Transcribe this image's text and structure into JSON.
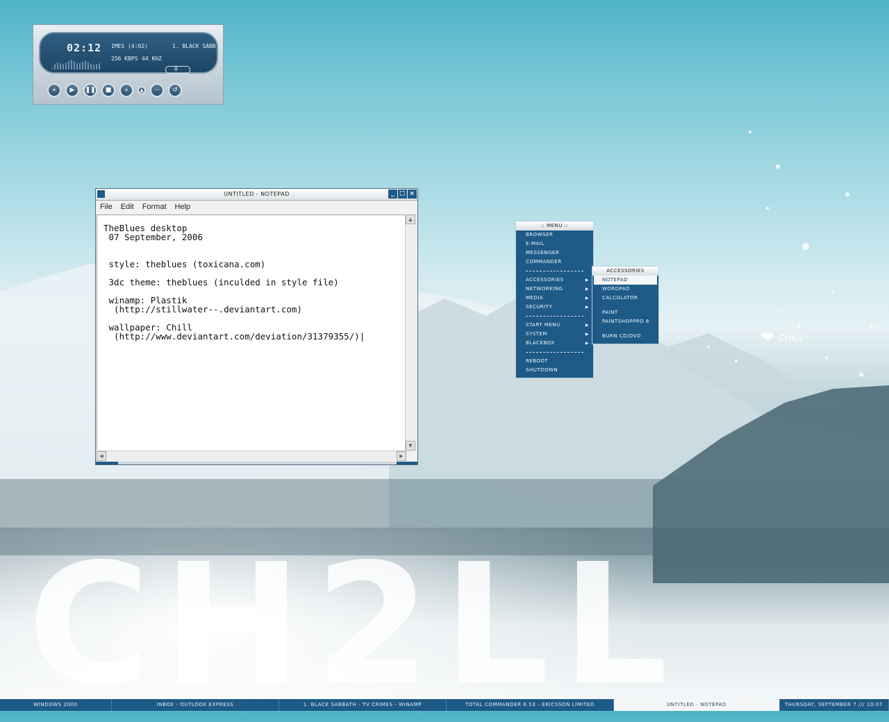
{
  "winamp": {
    "time": "02:12",
    "title_scroll": "IMES (4:02)",
    "track": "1. BLACK SABB",
    "kbps_label": "256 KBPS",
    "khz_label": "44 KHZ",
    "seek_label": "0"
  },
  "notepad": {
    "title": "UNTITLED - NOTEPAD",
    "menu": [
      "File",
      "Edit",
      "Format",
      "Help"
    ],
    "content": "TheBlues desktop\n 07 September, 2006\n\n\n style: theblues (toxicana.com)\n\n 3dc theme: theblues (inculded in style file)\n\n winamp: Plastik\n  (http://stillwater--.deviantart.com)\n\n wallpaper: Chill\n  (http://www.deviantart.com/deviation/31379355/)|"
  },
  "start_menu": {
    "title": ":: MENU ::",
    "items": [
      "BROWSER",
      "E-MAIL",
      "MESSENGER",
      "COMMANDER",
      "ACCESSORIES",
      "NETWORKING",
      "MEDIA",
      "SECURITY",
      "START MENU",
      "SYSTEM",
      "BLACKBOX",
      "REBOOT",
      "SHUTDOWN"
    ]
  },
  "submenu": {
    "title": "ACCESSORIES",
    "items": [
      "NOTEPAD",
      "WORDPAD",
      "CALCULATOR",
      "PAINT",
      "PAINTSHOPPRO 8",
      "BURN CD/DVD"
    ]
  },
  "wallpaper": {
    "logo_text": "CHILL",
    "big_text": "CH2LL"
  },
  "taskbar": {
    "items": [
      "WINDOWS 2000",
      "INBOX - OUTLOOK EXPRESS",
      "1. BLACK SABBATH - TV CRIMES - WINAMP",
      "TOTAL COMMANDER 6.53 - ERICSSON LIMITED",
      "UNTITLED - NOTEPAD"
    ],
    "clock": "THURSDAY, SEPTEMBER 7 /// 10:07"
  },
  "colors": {
    "accent": "#1e5a86",
    "menu_text": "#f2f7fb",
    "active_item_bg": "#f4f6f8"
  }
}
